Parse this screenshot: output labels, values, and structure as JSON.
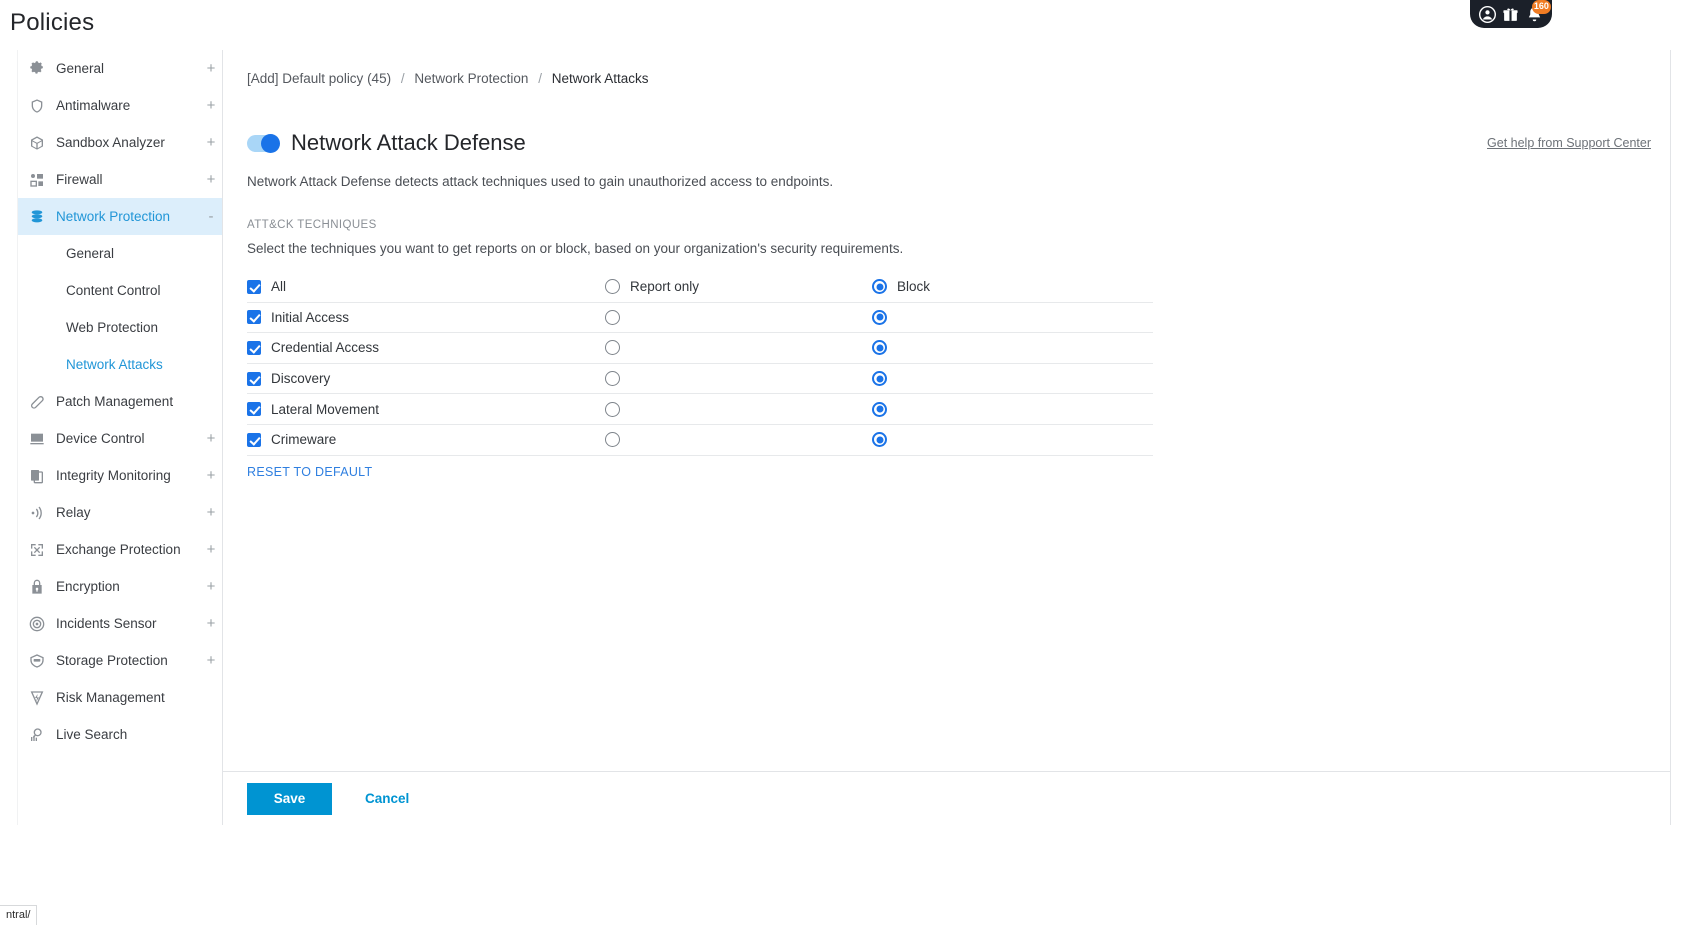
{
  "page": {
    "title": "Policies"
  },
  "topbar": {
    "account_icon": "person-icon",
    "gift_icon": "gift-icon",
    "notifications_icon": "bell-icon",
    "notifications_count": "160"
  },
  "sidebar": {
    "items": [
      {
        "label": "General",
        "icon": "gear-icon",
        "expander": "+",
        "active": false
      },
      {
        "label": "Antimalware",
        "icon": "shield-icon",
        "expander": "+",
        "active": false
      },
      {
        "label": "Sandbox Analyzer",
        "icon": "box-icon",
        "expander": "+",
        "active": false
      },
      {
        "label": "Firewall",
        "icon": "firewall-icon",
        "expander": "+",
        "active": false
      },
      {
        "label": "Network Protection",
        "icon": "layers-icon",
        "expander": "-",
        "active": true
      },
      {
        "label": "Patch Management",
        "icon": "bandage-icon",
        "expander": "",
        "active": false
      },
      {
        "label": "Device Control",
        "icon": "monitor-icon",
        "expander": "+",
        "active": false
      },
      {
        "label": "Integrity Monitoring",
        "icon": "copy-icon",
        "expander": "+",
        "active": false
      },
      {
        "label": "Relay",
        "icon": "broadcast-icon",
        "expander": "+",
        "active": false
      },
      {
        "label": "Exchange Protection",
        "icon": "exchange-icon",
        "expander": "+",
        "active": false
      },
      {
        "label": "Encryption",
        "icon": "lock-icon",
        "expander": "+",
        "active": false
      },
      {
        "label": "Incidents Sensor",
        "icon": "target-icon",
        "expander": "+",
        "active": false
      },
      {
        "label": "Storage Protection",
        "icon": "storage-icon",
        "expander": "+",
        "active": false
      },
      {
        "label": "Risk Management",
        "icon": "risk-icon",
        "expander": "",
        "active": false
      },
      {
        "label": "Live Search",
        "icon": "search-chart-icon",
        "expander": "",
        "active": false
      }
    ],
    "subitems": [
      {
        "label": "General",
        "active": false
      },
      {
        "label": "Content Control",
        "active": false
      },
      {
        "label": "Web Protection",
        "active": false
      },
      {
        "label": "Network Attacks",
        "active": true
      }
    ]
  },
  "breadcrumb": {
    "policy": "[Add] Default policy (45)",
    "section": "Network Protection",
    "current": "Network Attacks",
    "separator": "/"
  },
  "help": {
    "label": "Get help from Support Center"
  },
  "feature": {
    "title": "Network Attack Defense",
    "enabled": true,
    "description": "Network Attack Defense detects attack techniques used to gain unauthorized access to endpoints."
  },
  "techniques_section": {
    "label": "ATT&CK TECHNIQUES",
    "description": "Select the techniques you want to get reports on or block, based on your organization's security requirements.",
    "columns": {
      "name": "",
      "report": "Report only",
      "block": "Block"
    },
    "rows": [
      {
        "name": "All",
        "checked": true,
        "mode": "block",
        "show_option_labels": true
      },
      {
        "name": "Initial Access",
        "checked": true,
        "mode": "block",
        "show_option_labels": false
      },
      {
        "name": "Credential Access",
        "checked": true,
        "mode": "block",
        "show_option_labels": false
      },
      {
        "name": "Discovery",
        "checked": true,
        "mode": "block",
        "show_option_labels": false
      },
      {
        "name": "Lateral Movement",
        "checked": true,
        "mode": "block",
        "show_option_labels": false
      },
      {
        "name": "Crimeware",
        "checked": true,
        "mode": "block",
        "show_option_labels": false
      }
    ],
    "reset_label": "RESET TO DEFAULT"
  },
  "footer": {
    "save_label": "Save",
    "cancel_label": "Cancel"
  },
  "statusbar": {
    "text": "ntral/"
  },
  "colors": {
    "accent_blue": "#1a73e8",
    "link_blue": "#2196d7",
    "save_blue": "#0094d2",
    "active_nav_bg": "#dceefb",
    "badge_orange": "#f07c23",
    "topbar_dark": "#1b2029"
  }
}
